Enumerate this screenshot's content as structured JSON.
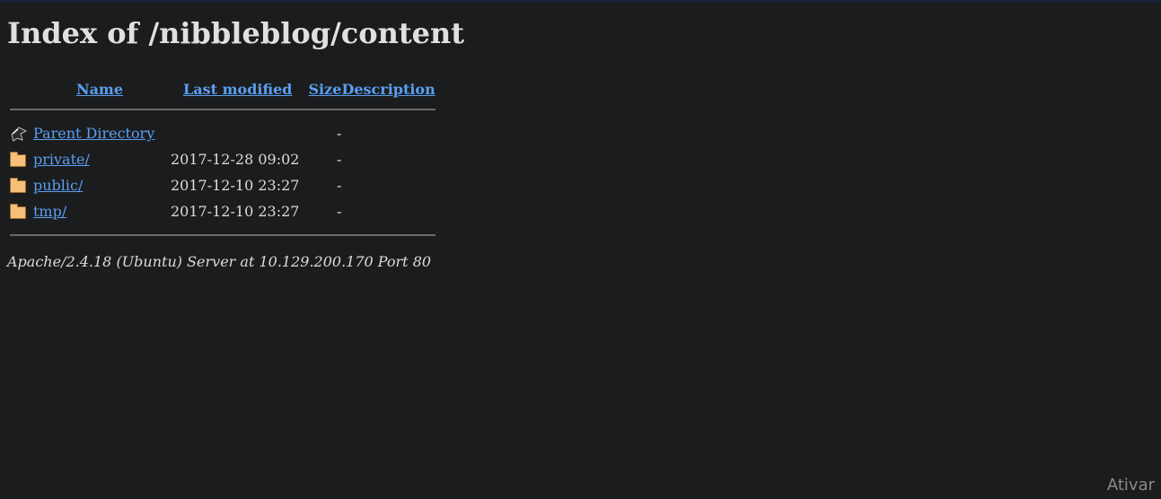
{
  "page": {
    "title": "Index of /nibbleblog/content"
  },
  "columns": {
    "name": "Name",
    "last_modified": "Last modified",
    "size": "Size",
    "description": "Description"
  },
  "entries": [
    {
      "icon": "back-icon",
      "name": "Parent Directory",
      "last_modified": "",
      "size": "-",
      "description": ""
    },
    {
      "icon": "folder-icon",
      "name": "private/",
      "last_modified": "2017-12-28 09:02",
      "size": "-",
      "description": ""
    },
    {
      "icon": "folder-icon",
      "name": "public/",
      "last_modified": "2017-12-10 23:27",
      "size": "-",
      "description": ""
    },
    {
      "icon": "folder-icon",
      "name": "tmp/",
      "last_modified": "2017-12-10 23:27",
      "size": "-",
      "description": ""
    }
  ],
  "footer": {
    "address": "Apache/2.4.18 (Ubuntu) Server at 10.129.200.170 Port 80"
  },
  "overlay": {
    "watermark": "Ativar"
  }
}
